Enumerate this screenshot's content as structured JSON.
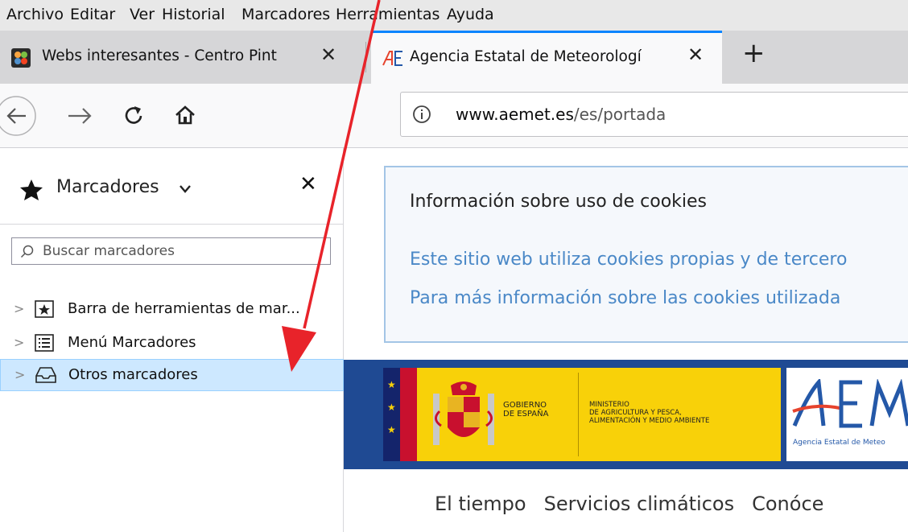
{
  "menubar": [
    "Archivo",
    "Editar",
    "Ver",
    "Historial",
    "Marcadores",
    "Herramientas",
    "Ayuda"
  ],
  "tabs": [
    {
      "title": "Webs interesantes - Centro Pint",
      "active": false
    },
    {
      "title": "Agencia Estatal de Meteorologí",
      "active": true
    }
  ],
  "new_tab_symbol": "+",
  "url": {
    "domain": "www.aemet.es",
    "path": "/es/portada"
  },
  "sidebar": {
    "title": "Marcadores",
    "search_placeholder": "Buscar marcadores",
    "items": [
      {
        "label": "Barra de herramientas de mar...",
        "icon": "bookmarks-toolbar-icon",
        "selected": false
      },
      {
        "label": "Menú Marcadores",
        "icon": "bookmarks-menu-icon",
        "selected": false
      },
      {
        "label": "Otros marcadores",
        "icon": "other-bookmarks-icon",
        "selected": true
      }
    ]
  },
  "page": {
    "cookie_title": "Información sobre uso de cookies",
    "cookie_line1": "Este sitio web utiliza cookies propias y de tercero",
    "cookie_line2": "Para más información sobre las cookies utilizada",
    "gov_line1": "GOBIERNO",
    "gov_line2": "DE ESPAÑA",
    "min_line1": "MINISTERIO",
    "min_line2": "DE AGRICULTURA Y PESCA,",
    "min_line3": "ALIMENTACIÓN Y MEDIO AMBIENTE",
    "aemet_caption": "Agencia Estatal de Meteo",
    "nav": [
      "El tiempo",
      "Servicios climáticos",
      "Conóce"
    ]
  },
  "colors": {
    "accent": "#0a84ff",
    "arrow": "#e8232a",
    "selection": "#cde8ff",
    "banner_blue": "#1f4a93",
    "gov_yellow": "#f8d109"
  }
}
